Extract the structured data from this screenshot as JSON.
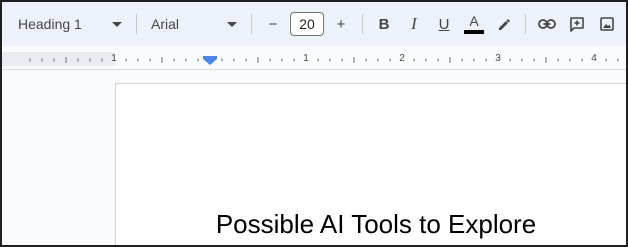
{
  "toolbar": {
    "paragraph_style": "Heading 1",
    "font_family": "Arial",
    "font_size": "20",
    "decrease_size": "−",
    "increase_size": "+",
    "bold": "B",
    "italic": "I",
    "underline": "U",
    "text_color_letter": "A",
    "text_color": "#000000"
  },
  "ruler": {
    "labels": [
      "1",
      "1",
      "2",
      "3",
      "4"
    ]
  },
  "document": {
    "heading": "Possible AI Tools to Explore"
  },
  "icons": [
    "dropdown-caret-icon",
    "bold-icon",
    "italic-icon",
    "underline-icon",
    "text-color-icon",
    "highlighter-icon",
    "link-icon",
    "add-comment-icon",
    "insert-image-icon",
    "indent-marker-icon"
  ]
}
